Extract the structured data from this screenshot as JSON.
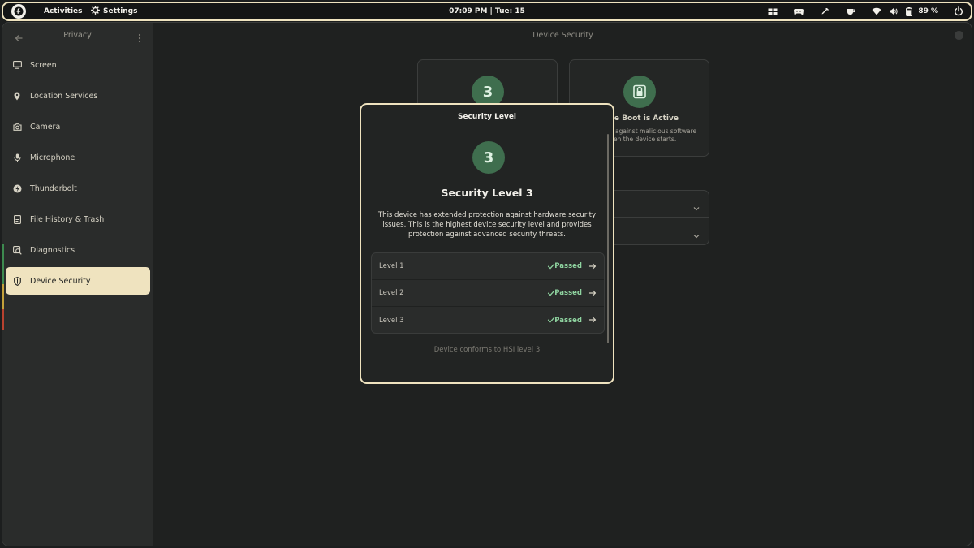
{
  "topbar": {
    "activities": "Activities",
    "app_name": "Settings",
    "clock": "07:09 PM  | Tue: 15",
    "battery_percent": "89 %",
    "icons": [
      "workspaces-icon",
      "gamepad-icon",
      "color-picker-icon",
      "coffee-icon",
      "wifi-icon",
      "volume-icon",
      "battery-icon",
      "power-icon"
    ]
  },
  "sidebar": {
    "title": "Privacy",
    "items": [
      {
        "label": "Screen",
        "icon": "display-icon"
      },
      {
        "label": "Location Services",
        "icon": "location-pin-icon"
      },
      {
        "label": "Camera",
        "icon": "camera-icon"
      },
      {
        "label": "Microphone",
        "icon": "microphone-icon"
      },
      {
        "label": "Thunderbolt",
        "icon": "thunderbolt-icon"
      },
      {
        "label": "File History & Trash",
        "icon": "file-history-icon"
      },
      {
        "label": "Diagnostics",
        "icon": "diagnostics-icon"
      },
      {
        "label": "Device Security",
        "icon": "shield-icon",
        "active": true
      }
    ]
  },
  "content": {
    "title": "Device Security",
    "security_level_badge": "3",
    "secure_boot_title": "ure Boot is Active",
    "secure_boot_line1": "against malicious software",
    "secure_boot_line2": "en the device starts."
  },
  "dialog": {
    "title": "Security Level",
    "badge": "3",
    "heading": "Security Level 3",
    "description": "This device has extended protection against hardware security issues. This is the highest device security level and provides protection against advanced security threats.",
    "levels": [
      {
        "name": "Level 1",
        "status": "Passed"
      },
      {
        "name": "Level 2",
        "status": "Passed"
      },
      {
        "name": "Level 3",
        "status": "Passed"
      }
    ],
    "footer": "Device conforms to HSI level 3"
  },
  "colors": {
    "accent": "#efe3bf",
    "success": "#8fd4a0",
    "badge_bg": "#3f6e4e"
  }
}
